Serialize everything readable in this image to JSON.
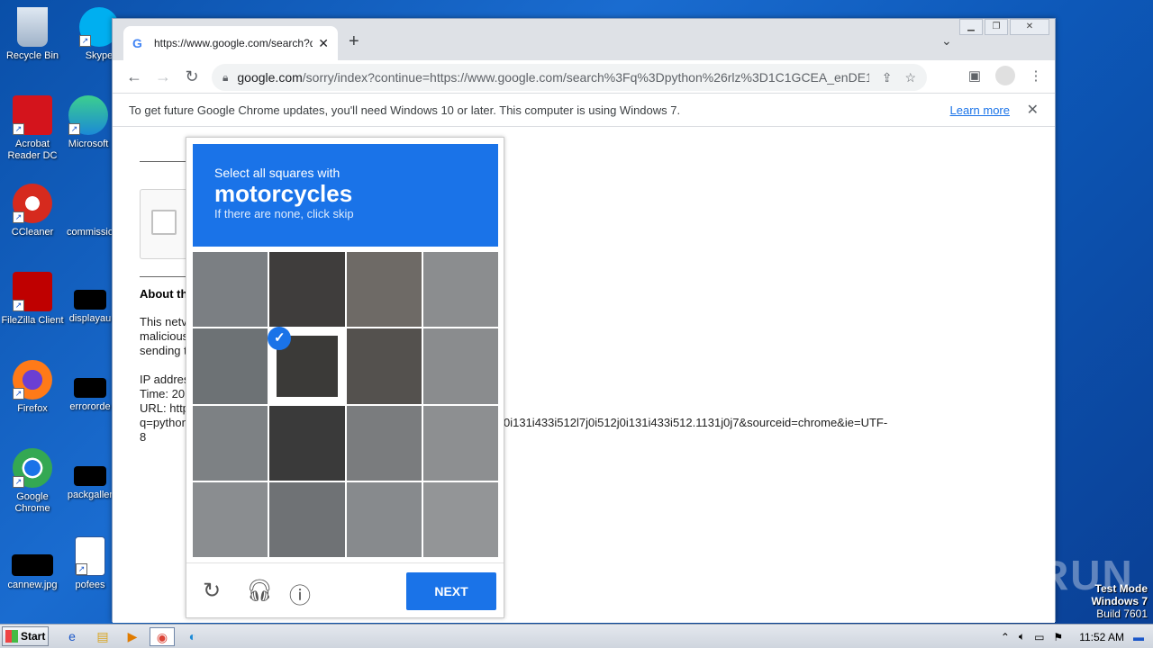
{
  "desktop": {
    "icons": [
      {
        "label": "Recycle Bin"
      },
      {
        "label": "Skype"
      },
      {
        "label": "Acrobat Reader DC"
      },
      {
        "label": "Microsoft"
      },
      {
        "label": "CCleaner"
      },
      {
        "label": "commissio"
      },
      {
        "label": "FileZilla Client"
      },
      {
        "label": "displayau"
      },
      {
        "label": "Firefox"
      },
      {
        "label": "errororde"
      },
      {
        "label": "Google Chrome"
      },
      {
        "label": "packgaller"
      },
      {
        "label": "cannew.jpg"
      },
      {
        "label": "pofees"
      }
    ]
  },
  "browser": {
    "tab": {
      "title": "https://www.google.com/search?q=",
      "close": "✕"
    },
    "newtab": "+",
    "url_host": "google.com",
    "url_path": "/sorry/index?continue=https://www.google.com/search%3Fq%3Dpython%26rlz%3D1C1GCEA_enDE1...",
    "infobar": {
      "message": "To get future Google Chrome updates, you'll need Windows 10 or later. This computer is using Windows 7.",
      "link": "Learn more"
    }
  },
  "sorry_page": {
    "about_heading": "About th",
    "paragraph": "This netv\nmalicious\nsending t\n\nIP addres\nTime: 20\nURL: http\nq=python\n8",
    "url_tail": "0i131i433i512l7j0i512j0i131i433i512.1131j0j7&sourceid=chrome&ie=UTF-"
  },
  "captcha": {
    "line1": "Select all squares with",
    "target": "motorcycles",
    "line3": "If there are none, click skip",
    "selected_tiles": [
      5
    ],
    "next_label": "NEXT"
  },
  "watermark": "ANY RUN",
  "build": {
    "mode": "Test Mode",
    "os": "Windows 7",
    "build": "Build 7601"
  },
  "taskbar": {
    "start": "Start",
    "clock": "11:52 AM"
  }
}
